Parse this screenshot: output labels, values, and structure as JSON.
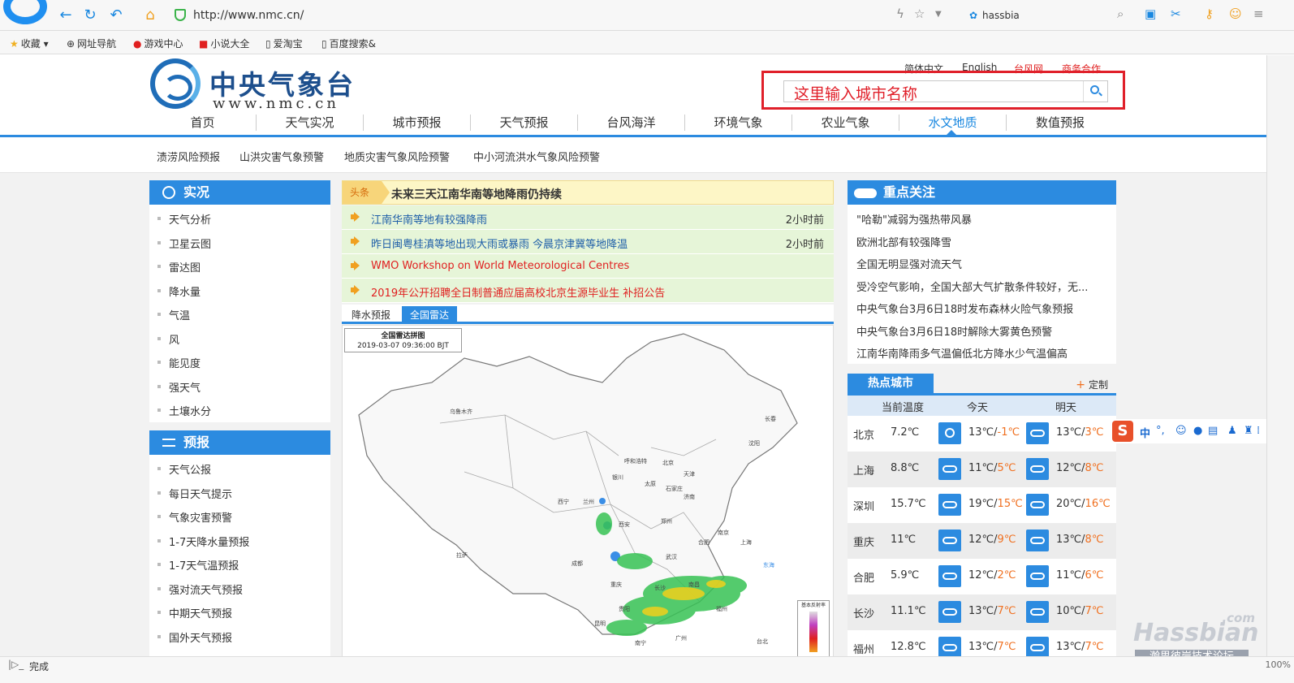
{
  "browser": {
    "url": "http://www.nmc.cn/",
    "user": "hassbia"
  },
  "bookmarks": [
    {
      "label": "收藏",
      "icon": "star-icon"
    },
    {
      "label": "网址导航",
      "icon": "globe-icon"
    },
    {
      "label": "游戏中心",
      "icon": "game-icon"
    },
    {
      "label": "小说大全",
      "icon": "book-icon"
    },
    {
      "label": "爱淘宝",
      "icon": "page-icon"
    },
    {
      "label": "百度搜索&",
      "icon": "page-icon"
    }
  ],
  "site": {
    "title": "中央气象台",
    "url_text": "www.nmc.cn",
    "top_links": [
      "简体中文",
      "English",
      "台风网",
      "商务合作"
    ],
    "search_placeholder": "这里输入城市名称"
  },
  "main_nav": [
    "首页",
    "天气实况",
    "城市预报",
    "天气预报",
    "台风海洋",
    "环境气象",
    "农业气象",
    "水文地质",
    "数值预报"
  ],
  "main_nav_active": "水文地质",
  "sub_nav": [
    "渍涝风险预报",
    "山洪灾害气象预警",
    "地质灾害气象风险预警",
    "中小河流洪水气象风险预警"
  ],
  "left_panels": {
    "live": {
      "title": "实况",
      "items": [
        "天气分析",
        "卫星云图",
        "雷达图",
        "降水量",
        "气温",
        "风",
        "能见度",
        "强天气",
        "土壤水分"
      ]
    },
    "forecast": {
      "title": "预报",
      "items": [
        "天气公报",
        "每日天气提示",
        "气象灾害预警",
        "1-7天降水量预报",
        "1-7天气温预报",
        "强对流天气预报",
        "中期天气预报",
        "国外天气预报"
      ]
    }
  },
  "headline": {
    "tag": "头条",
    "text": "未来三天江南华南等地降雨仍持续"
  },
  "news": [
    {
      "text": "江南华南等地有较强降雨",
      "time": "2小时前",
      "color": "#1f5fa8"
    },
    {
      "text": "昨日闽粤桂滇等地出现大雨或暴雨 今晨京津冀等地降温",
      "time": "2小时前",
      "color": "#1f5fa8"
    },
    {
      "text": "WMO Workshop on World Meteorological Centres",
      "time": "",
      "color": "#e02020"
    },
    {
      "text": "2019年公开招聘全日制普通应届高校北京生源毕业生 补招公告",
      "time": "",
      "color": "#e02020"
    }
  ],
  "map_tabs": [
    "降水预报",
    "全国雷达"
  ],
  "map_tab_active": "全国雷达",
  "radar": {
    "caption": "全国雷达拼图",
    "time": "2019-03-07 09:36:00 BJT",
    "legend_title": "基本反射率"
  },
  "map_labels": [
    "乌鲁木齐",
    "呼和浩特",
    "北京",
    "天津",
    "太原",
    "石家庄",
    "银川",
    "兰州",
    "西宁",
    "西安",
    "郑州",
    "济南",
    "合肥",
    "南京",
    "上海",
    "武汉",
    "长沙",
    "南昌",
    "福州",
    "成都",
    "重庆",
    "贵阳",
    "昆明",
    "南宁",
    "广州",
    "拉萨",
    "沈阳",
    "长春",
    "台北",
    "东海"
  ],
  "focus": {
    "title": "重点关注",
    "items": [
      "\"哈勒\"减弱为强热带风暴",
      "欧洲北部有较强降雪",
      "全国无明显强对流天气",
      "受冷空气影响，全国大部大气扩散条件较好，无...",
      "中央气象台3月6日18时发布森林火险气象预报",
      "中央气象台3月6日18时解除大雾黄色预警",
      "江南华南降雨多气温偏低北方降水少气温偏高"
    ]
  },
  "hot_cities": {
    "title": "热点城市",
    "custom_label": "定制",
    "columns": [
      "当前温度",
      "今天",
      "明天"
    ],
    "rows": [
      {
        "city": "北京",
        "current": "7.2℃",
        "today_hi": "13℃",
        "today_lo": "-1℃",
        "tomorrow_hi": "13℃",
        "tomorrow_lo": "3℃",
        "today_icon": "sun-icon",
        "tomorrow_icon": "partly-cloudy-icon"
      },
      {
        "city": "上海",
        "current": "8.8℃",
        "today_hi": "11℃",
        "today_lo": "5℃",
        "tomorrow_hi": "12℃",
        "tomorrow_lo": "8℃",
        "today_icon": "partly-cloudy-icon",
        "tomorrow_icon": "cloudy-icon"
      },
      {
        "city": "深圳",
        "current": "15.7℃",
        "today_hi": "19℃",
        "today_lo": "15℃",
        "tomorrow_hi": "20℃",
        "tomorrow_lo": "16℃",
        "today_icon": "rain-icon",
        "tomorrow_icon": "rain-icon"
      },
      {
        "city": "重庆",
        "current": "11℃",
        "today_hi": "12℃",
        "today_lo": "9℃",
        "tomorrow_hi": "13℃",
        "tomorrow_lo": "8℃",
        "today_icon": "cloudy-icon",
        "tomorrow_icon": "cloudy-icon"
      },
      {
        "city": "合肥",
        "current": "5.9℃",
        "today_hi": "12℃",
        "today_lo": "2℃",
        "tomorrow_hi": "11℃",
        "tomorrow_lo": "6℃",
        "today_icon": "partly-cloudy-icon",
        "tomorrow_icon": "cloudy-icon"
      },
      {
        "city": "长沙",
        "current": "11.1℃",
        "today_hi": "13℃",
        "today_lo": "7℃",
        "tomorrow_hi": "10℃",
        "tomorrow_lo": "7℃",
        "today_icon": "cloudy-icon",
        "tomorrow_icon": "rain-icon"
      },
      {
        "city": "福州",
        "current": "12.8℃",
        "today_hi": "13℃",
        "today_lo": "7℃",
        "tomorrow_hi": "13℃",
        "tomorrow_lo": "7℃",
        "today_icon": "rain-icon",
        "tomorrow_icon": "rain-icon"
      }
    ]
  },
  "ime": {
    "mode": "中"
  },
  "watermark": {
    "com": ".com",
    "name": "Hassbian",
    "sub": "瀚思彼岸技术论坛"
  },
  "status": {
    "text": "完成",
    "zoom": "100%"
  }
}
